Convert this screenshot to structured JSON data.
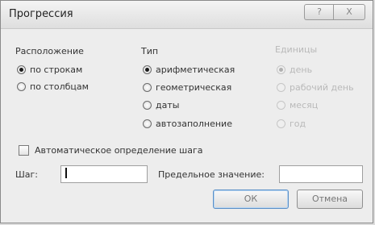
{
  "title": "Прогрессия",
  "titlebar_buttons": {
    "help": "?",
    "close": "X"
  },
  "groups": {
    "location": {
      "label": "Расположение",
      "options": [
        {
          "label": "по строкам",
          "checked": true
        },
        {
          "label": "по столбцам",
          "checked": false
        }
      ]
    },
    "type": {
      "label": "Тип",
      "options": [
        {
          "label": "арифметическая",
          "checked": true
        },
        {
          "label": "геометрическая",
          "checked": false
        },
        {
          "label": "даты",
          "checked": false
        },
        {
          "label": "автозаполнение",
          "checked": false
        }
      ]
    },
    "units": {
      "label": "Единицы",
      "disabled": true,
      "options": [
        {
          "label": "день",
          "checked": true
        },
        {
          "label": "рабочий день",
          "checked": false
        },
        {
          "label": "месяц",
          "checked": false
        },
        {
          "label": "год",
          "checked": false
        }
      ]
    }
  },
  "auto_step": {
    "label": "Автоматическое определение шага",
    "checked": false
  },
  "step": {
    "label": "Шаг:",
    "value": ""
  },
  "limit": {
    "label": "Предельное значение:",
    "value": ""
  },
  "buttons": {
    "ok": "ОК",
    "cancel": "Отмена"
  }
}
